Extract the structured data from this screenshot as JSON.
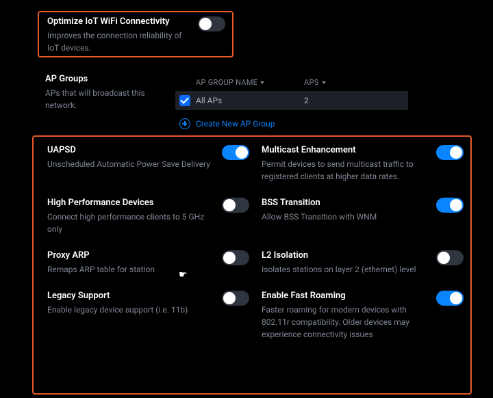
{
  "iot": {
    "title": "Optimize IoT WiFi Connectivity",
    "desc": "Improves the connection reliability of IoT devices.",
    "enabled": false
  },
  "ap_groups": {
    "title": "AP Groups",
    "desc": "APs that will broadcast this network.",
    "headers": {
      "name": "AP GROUP NAME",
      "aps": "APS"
    },
    "rows": [
      {
        "checked": true,
        "name": "All APs",
        "aps": "2"
      }
    ],
    "create_label": "Create New AP Group"
  },
  "settings": [
    {
      "key": "uapsd",
      "title": "UAPSD",
      "desc": "Unscheduled Automatic Power Save Delivery",
      "enabled": true
    },
    {
      "key": "multicast",
      "title": "Multicast Enhancement",
      "desc": "Permit devices to send multicast traffic to registered clients at higher data rates.",
      "enabled": true
    },
    {
      "key": "high_perf",
      "title": "High Performance Devices",
      "desc": "Connect high performance clients to 5 GHz only",
      "enabled": false
    },
    {
      "key": "bss",
      "title": "BSS Transition",
      "desc": "Allow BSS Transition with WNM",
      "enabled": true
    },
    {
      "key": "proxy_arp",
      "title": "Proxy ARP",
      "desc": "Remaps ARP table for station",
      "enabled": false
    },
    {
      "key": "l2_iso",
      "title": "L2 Isolation",
      "desc": "Isolates stations on layer 2 (ethernet) level",
      "enabled": false
    },
    {
      "key": "legacy",
      "title": "Legacy Support",
      "desc": "Enable legacy device support (i.e. 11b)",
      "enabled": false
    },
    {
      "key": "fast_roam",
      "title": "Enable Fast Roaming",
      "desc": "Faster roaming for modern devices with 802.11r compatibility. Older devices may experience connectivity issues",
      "enabled": true
    }
  ]
}
